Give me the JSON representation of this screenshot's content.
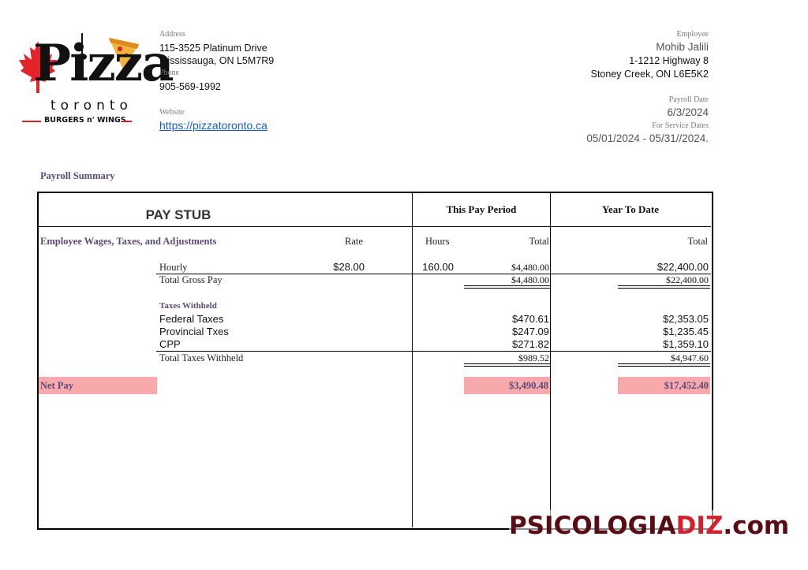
{
  "company": {
    "logo_text_main": "Pizza",
    "logo_text_city": "toronto",
    "logo_text_tag": "BURGERS n' WINGS",
    "address_label": "Address",
    "address_line1": "115-3525 Platinum Drive",
    "address_line2": "Mississauga, ON L5M7R9",
    "phone_label": "Phone",
    "phone": "905-569-1992",
    "website_label": "Website",
    "website": "https://pizzatoronto.ca"
  },
  "employee": {
    "label": "Employee",
    "name": "Mohib Jalili",
    "address_line1": "1-1212 Highway 8",
    "address_line2": "Stoney Creek, ON L6E5K2",
    "payroll_date_label": "Payroll Date",
    "payroll_date": "6/3/2024",
    "service_dates_label": "For Service Dates",
    "service_dates": "05/01/2024 - 05/31//2024."
  },
  "summary_title": "Payroll Summary",
  "stub": {
    "title": "PAY STUB",
    "this_period_header": "This Pay Period",
    "ytd_header": "Year To Date",
    "section_header": "Employee Wages, Taxes, and Adjustments",
    "col_rate": "Rate",
    "col_hours": "Hours",
    "col_total": "Total",
    "col_ytd_total": "Total",
    "hourly_label": "Hourly",
    "hourly_rate": "$28.00",
    "hourly_hours": "160.00",
    "hourly_total": "$4,480.00",
    "hourly_ytd": "$22,400.00",
    "gross_label": "Total Gross Pay",
    "gross_total": "$4,480.00",
    "gross_ytd": "$22,400.00",
    "taxes_header": "Taxes Withheld",
    "taxes": [
      {
        "label": "Federal Taxes",
        "total": "$470.61",
        "ytd": "$2,353.05"
      },
      {
        "label": "Provincial Txes",
        "total": "$247.09",
        "ytd": "$1,235.45"
      },
      {
        "label": "CPP",
        "total": "$271.82",
        "ytd": "$1,359.10"
      }
    ],
    "taxes_total_label": "Total Taxes Withheld",
    "taxes_total": "$989.52",
    "taxes_total_ytd": "$4,947.60",
    "net_label": "Net Pay",
    "net_total": "$3,490.48",
    "net_ytd": "$17,452.40"
  },
  "watermark": {
    "part1": "PSICOLOGIA",
    "part2": "DIZ",
    "part3": ".com"
  },
  "colors": {
    "highlight": "#f7a9ab",
    "link": "#1a5cc8",
    "watermark_dark": "#5a0c14",
    "watermark_red": "#d4202c"
  }
}
